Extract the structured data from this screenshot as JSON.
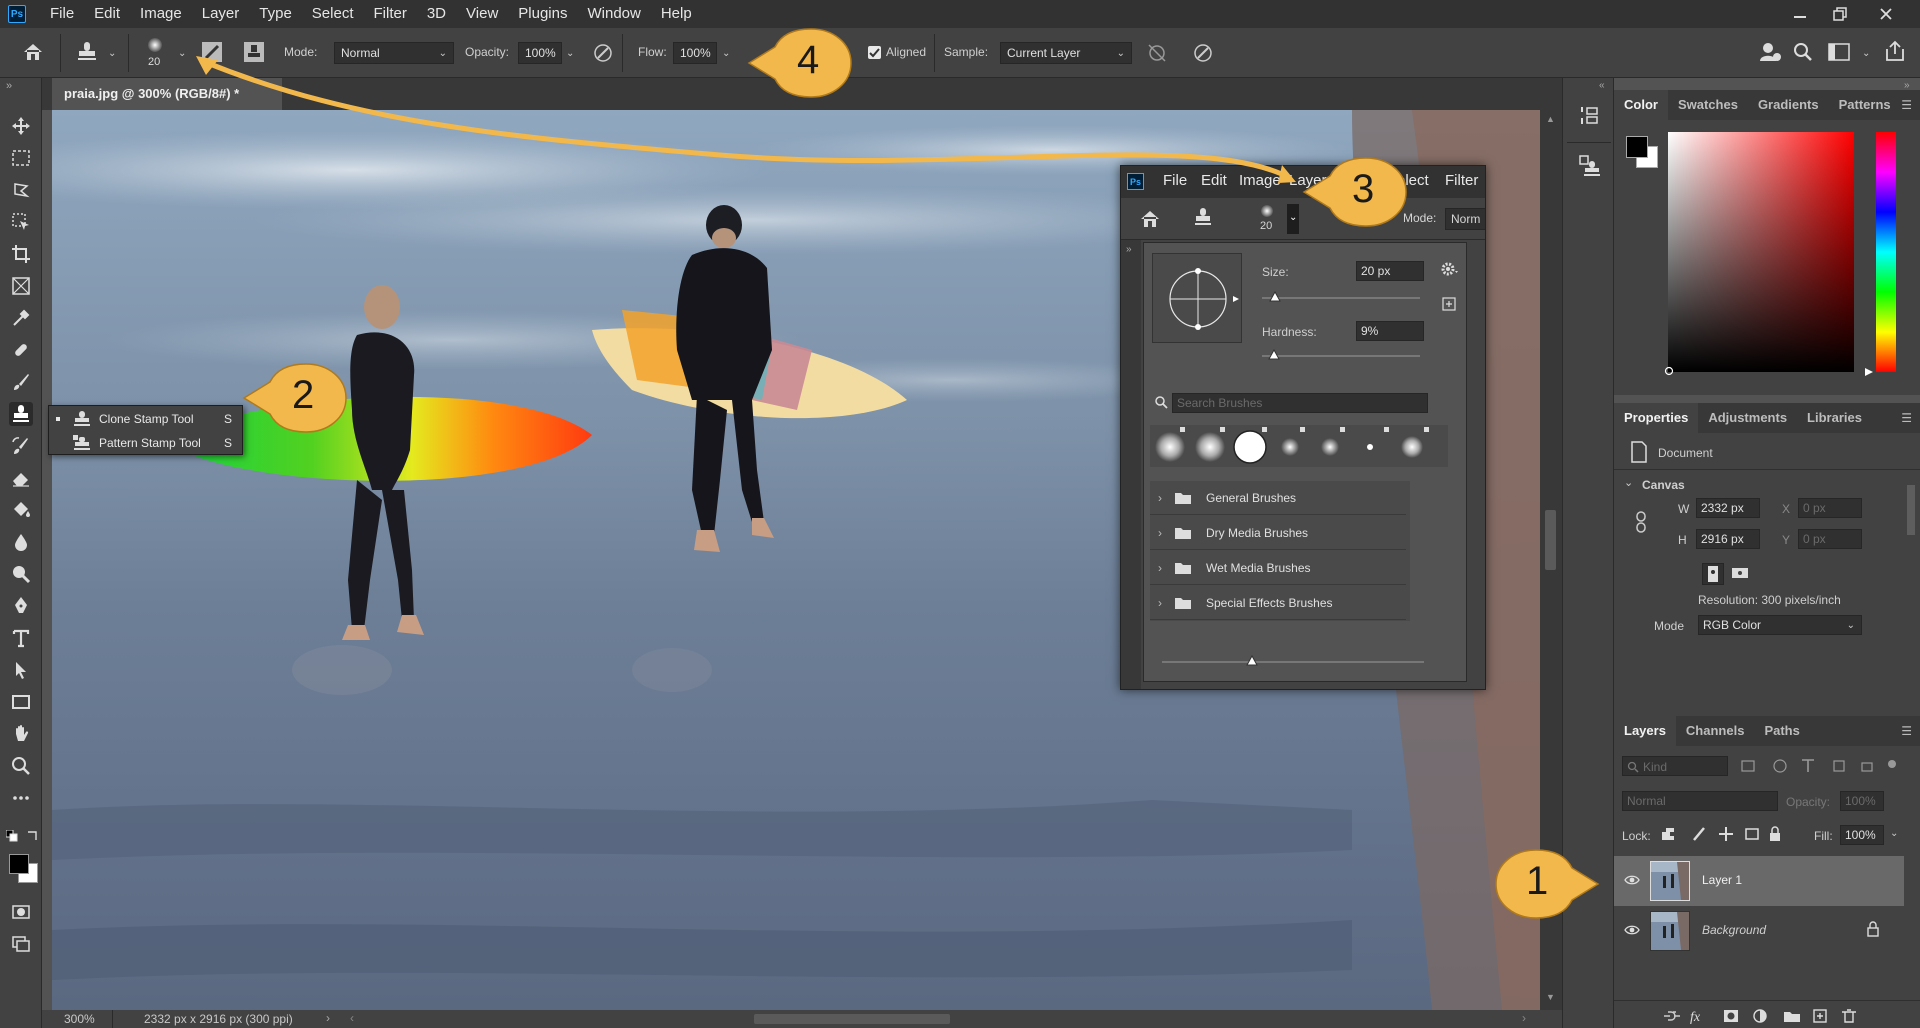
{
  "app": {
    "logo": "Ps",
    "menu": [
      "File",
      "Edit",
      "Image",
      "Layer",
      "Type",
      "Select",
      "Filter",
      "3D",
      "View",
      "Plugins",
      "Window",
      "Help"
    ]
  },
  "options": {
    "brush_size": "20",
    "mode_label": "Mode:",
    "mode_value": "Normal",
    "opacity_label": "Opacity:",
    "opacity_value": "100%",
    "flow_label": "Flow:",
    "flow_value": "100%",
    "aligned_label": "Aligned",
    "aligned_checked": true,
    "sample_label": "Sample:",
    "sample_value": "Current Layer"
  },
  "document": {
    "tab_title": "praia.jpg @ 300% (RGB/8#) *",
    "zoom": "300%",
    "doc_info": "2332 px x 2916 px (300 ppi)"
  },
  "tool_flyout": {
    "items": [
      {
        "label": "Clone Stamp Tool",
        "shortcut": "S",
        "active": true
      },
      {
        "label": "Pattern Stamp Tool",
        "shortcut": "S",
        "active": false
      }
    ]
  },
  "inset": {
    "logo": "Ps",
    "menu": [
      "File",
      "Edit",
      "Image",
      "Layer",
      "Select",
      "Filter"
    ],
    "brush_size": "20",
    "mode_label": "Mode:",
    "mode_value": "Norm",
    "size_label": "Size:",
    "size_value": "20 px",
    "hardness_label": "Hardness:",
    "hardness_value": "9%",
    "search_placeholder": "Search Brushes",
    "folders": [
      "General Brushes",
      "Dry Media Brushes",
      "Wet Media Brushes",
      "Special Effects Brushes"
    ]
  },
  "color_panel": {
    "tabs": [
      "Color",
      "Swatches",
      "Gradients",
      "Patterns"
    ],
    "foreground": "#000000",
    "background": "#ffffff",
    "hue": "#ff0000"
  },
  "properties_panel": {
    "tabs": [
      "Properties",
      "Adjustments",
      "Libraries"
    ],
    "doc_label": "Document",
    "section": "Canvas",
    "w_label": "W",
    "w_value": "2332 px",
    "h_label": "H",
    "h_value": "2916 px",
    "x_label": "X",
    "x_value": "0 px",
    "y_label": "Y",
    "y_value": "0 px",
    "resolution": "Resolution: 300 pixels/inch",
    "mode_label": "Mode",
    "mode_value": "RGB Color"
  },
  "layers_panel": {
    "tabs": [
      "Layers",
      "Channels",
      "Paths"
    ],
    "kind_placeholder": "Kind",
    "blend_mode": "Normal",
    "opacity_label": "Opacity:",
    "opacity_value": "100%",
    "lock_label": "Lock:",
    "fill_label": "Fill:",
    "fill_value": "100%",
    "layers": [
      {
        "name": "Layer 1",
        "selected": true,
        "italic": false,
        "locked": false
      },
      {
        "name": "Background",
        "selected": false,
        "italic": true,
        "locked": true
      }
    ]
  },
  "callouts": [
    "1",
    "2",
    "3",
    "4"
  ],
  "colors": {
    "callout_fill": "#f2b84b",
    "callout_stroke": "#b07a1c",
    "arrow": "#f2b84b"
  }
}
